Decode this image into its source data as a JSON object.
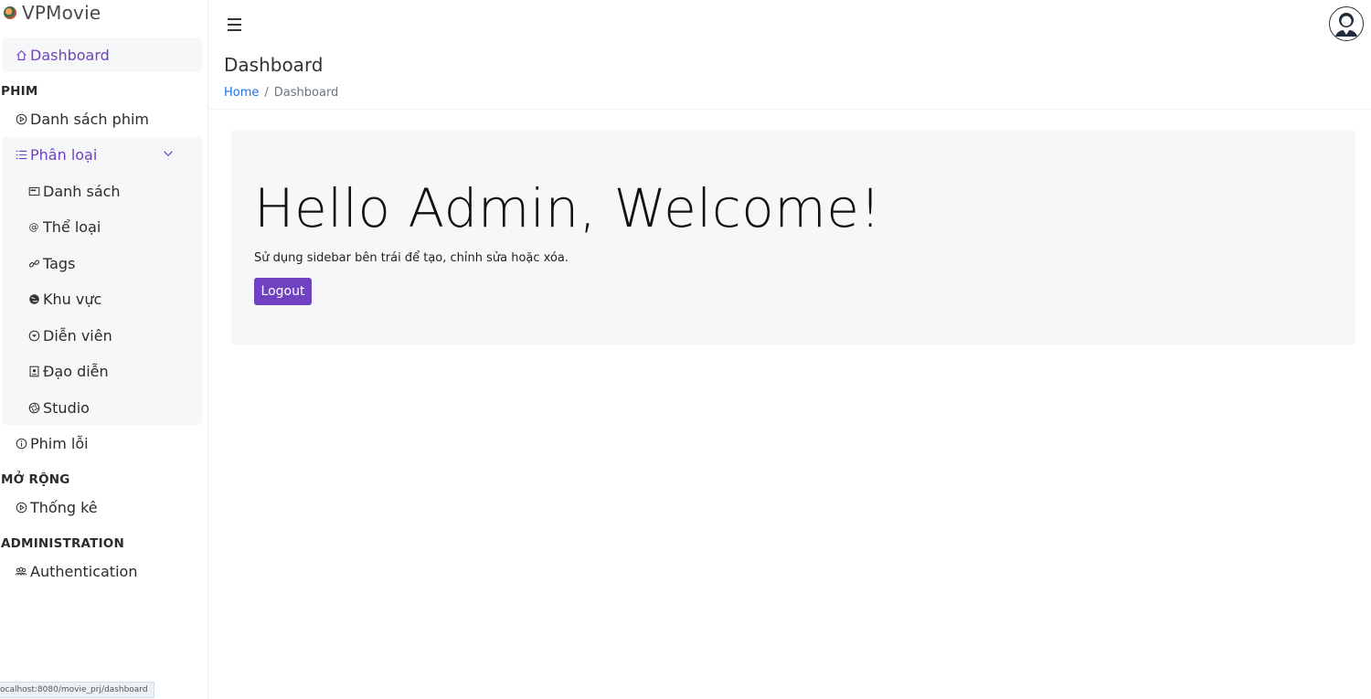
{
  "brand": {
    "name": "VPMovie"
  },
  "sidebar": {
    "dashboard": "Dashboard",
    "sections": {
      "phim": "PHIM",
      "mo_rong": "MỞ RỘNG",
      "administration": "ADMINISTRATION"
    },
    "danh_sach_phim": "Danh sách phim",
    "phan_loai": "Phân loại",
    "sub": {
      "danh_sach": "Danh sách",
      "the_loai": "Thể loại",
      "tags": "Tags",
      "khu_vuc": "Khu vực",
      "dien_vien": "Diễn viên",
      "dao_dien": "Đạo diễn",
      "studio": "Studio"
    },
    "phim_loi": "Phim lỗi",
    "thong_ke": "Thống kê",
    "authentication": "Authentication"
  },
  "page": {
    "title": "Dashboard",
    "breadcrumb": {
      "home": "Home",
      "separator": "/",
      "current": "Dashboard"
    }
  },
  "welcome": {
    "heading": "Hello Admin, Welcome!",
    "description": "Sử dụng sidebar bên trái để tạo, chỉnh sửa hoặc xóa.",
    "logout_label": "Logout"
  },
  "status_bar": {
    "url": "ocalhost:8080/movie_prj/dashboard"
  },
  "colors": {
    "accent": "#6f42c1",
    "link": "#1a73e8",
    "panel": "#f6f7f9"
  }
}
